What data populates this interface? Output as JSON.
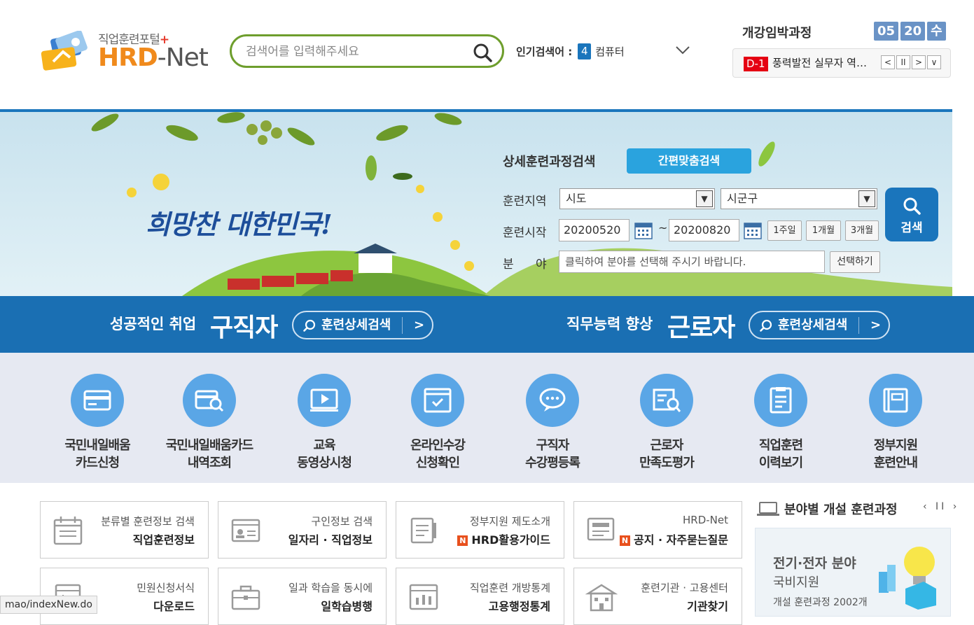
{
  "logo": {
    "tagline": "직업훈련포털",
    "tagline_plus": "+",
    "brand_hrd": "HRD",
    "brand_net": "-Net"
  },
  "search": {
    "placeholder": "검색어를 입력해주세요"
  },
  "popular": {
    "label": "인기검색어 :",
    "rank": "4",
    "keyword": "컴퓨터"
  },
  "upcoming": {
    "title": "개강임박과정",
    "date": {
      "month": "05",
      "day": "20",
      "weekday": "수"
    },
    "dday": "D-1",
    "course": "풍력발전 실무자 역량강화",
    "controls": [
      "<",
      "II",
      ">",
      "∨"
    ]
  },
  "hero": {
    "slogan": "희망찬 대한민국!",
    "detail_title": "상세훈련과정검색",
    "quick_search": "간편맞춤검색",
    "region_label": "훈련지역",
    "region_sido": "시도",
    "region_sigungu": "시군구",
    "start_label": "훈련시작",
    "date_from": "20200520",
    "tilde": "~",
    "date_to": "20200820",
    "range_buttons": [
      "1주일",
      "1개월",
      "3개월"
    ],
    "field_label_1": "분",
    "field_label_2": "야",
    "field_placeholder": "클릭하여 분야를 선택해 주시기 바랍니다.",
    "field_button": "선택하기",
    "search_button": "검색"
  },
  "band": {
    "left_small": "성공적인 취업",
    "left_big": "구직자",
    "left_btn": "훈련상세검색",
    "right_small": "직무능력 향상",
    "right_big": "근로자",
    "right_btn": "훈련상세검색",
    "chevron": ">"
  },
  "quick_menu": [
    {
      "line1": "국민내일배움",
      "line2": "카드신청",
      "icon": "card-icon"
    },
    {
      "line1": "국민내일배움카드",
      "line2": "내역조회",
      "icon": "card-search-icon"
    },
    {
      "line1": "교육",
      "line2": "동영상시청",
      "icon": "video-icon"
    },
    {
      "line1": "온라인수강",
      "line2": "신청확인",
      "icon": "browser-check-icon"
    },
    {
      "line1": "구직자",
      "line2": "수강평등록",
      "icon": "chat-icon"
    },
    {
      "line1": "근로자",
      "line2": "만족도평가",
      "icon": "doc-search-icon"
    },
    {
      "line1": "직업훈련",
      "line2": "이력보기",
      "icon": "clipboard-icon"
    },
    {
      "line1": "정부지원",
      "line2": "훈련안내",
      "icon": "book-icon"
    }
  ],
  "tiles": [
    {
      "sub": "분류별 훈련정보 검색",
      "main": "직업훈련정보",
      "badge": ""
    },
    {
      "sub": "구인정보 검색",
      "main": "일자리 · 직업정보",
      "badge": ""
    },
    {
      "sub": "정부지원 제도소개",
      "main": "HRD활용가이드",
      "badge": "N"
    },
    {
      "sub": "HRD-Net",
      "main": "공지 · 자주묻는질문",
      "badge": "N"
    },
    {
      "sub": "민원신청서식",
      "main": "다운로드",
      "badge": ""
    },
    {
      "sub": "일과 학습을 동시에",
      "main": "일학습병행",
      "badge": ""
    },
    {
      "sub": "직업훈련 개방통계",
      "main": "고용행정통계",
      "badge": ""
    },
    {
      "sub": "훈련기관 · 고용센터",
      "main": "기관찾기",
      "badge": ""
    }
  ],
  "field_courses": {
    "title": "분야별 개설 훈련과정",
    "controls": "‹ II ›",
    "line1": "전기·전자 분야",
    "line2": "국비지원",
    "line3": "개설 훈련과정 2002개"
  },
  "status_url": "mao/indexNew.do",
  "colors": {
    "brand_blue": "#1a75bc",
    "search_green": "#6e9e2d",
    "icon_blue": "#5aa6e6",
    "logo_orange": "#f08a1c",
    "badge_red": "#e50012"
  }
}
